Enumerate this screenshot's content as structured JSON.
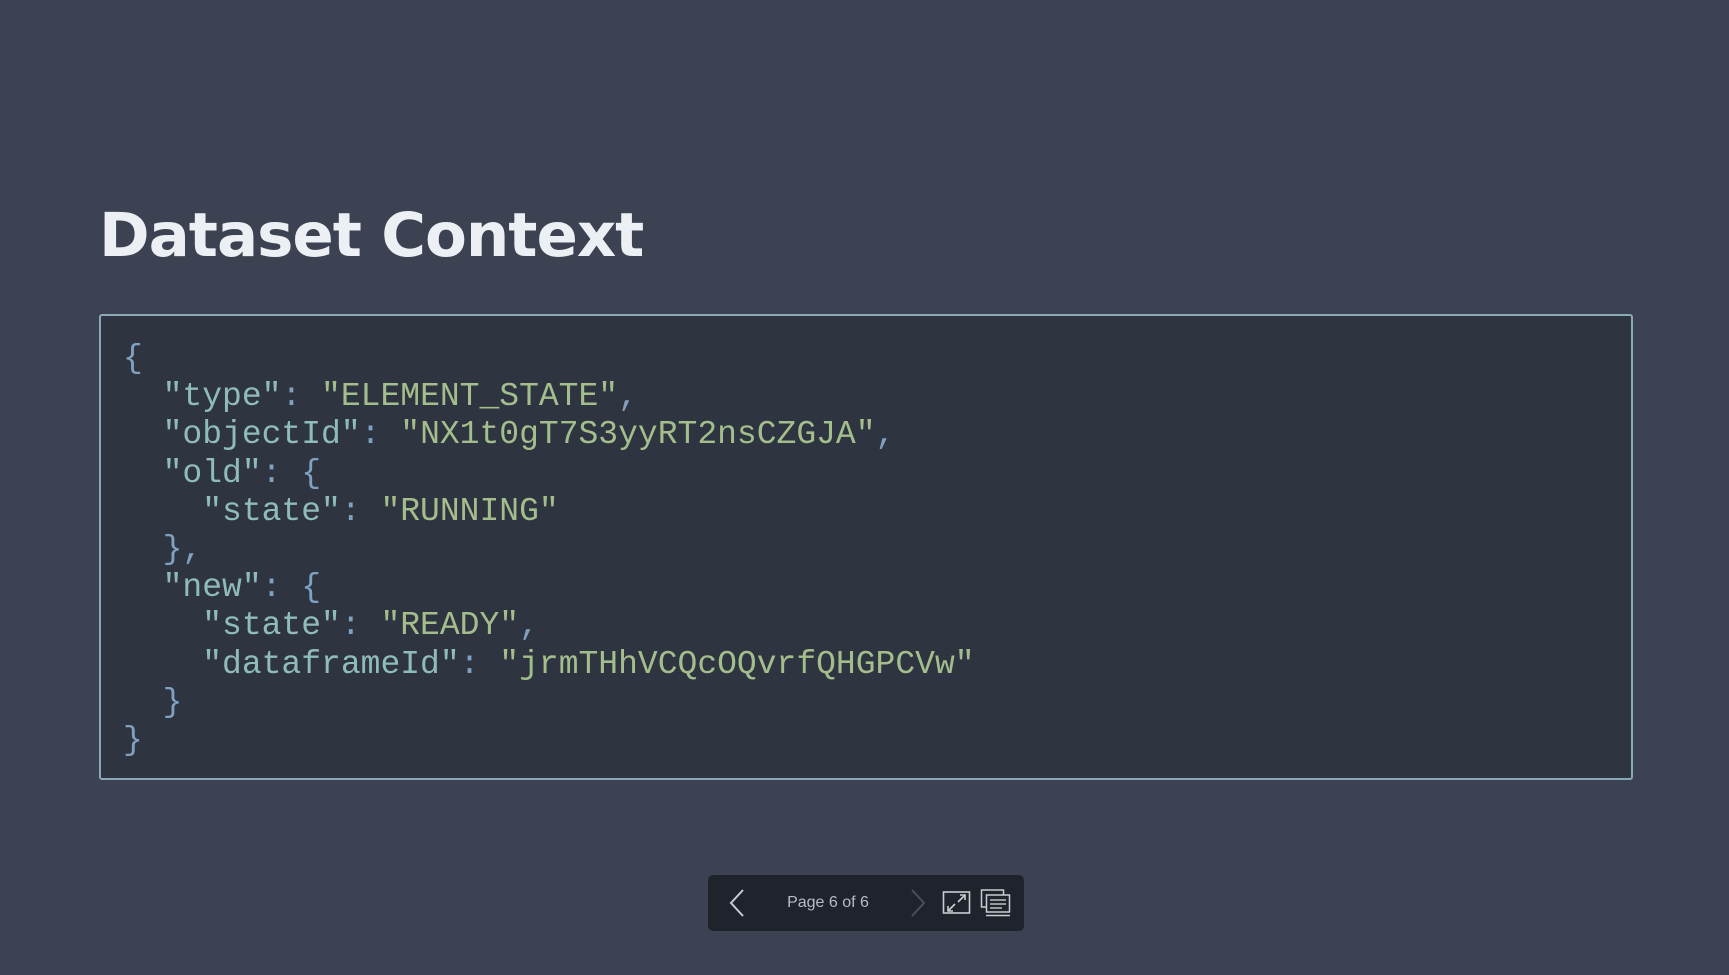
{
  "slide": {
    "title": "Dataset Context"
  },
  "code": {
    "lines": [
      [
        {
          "t": "{",
          "c": "punct"
        }
      ],
      [
        {
          "t": "  ",
          "c": "punct"
        },
        {
          "t": "\"type\"",
          "c": "key"
        },
        {
          "t": ": ",
          "c": "punct"
        },
        {
          "t": "\"ELEMENT_STATE\"",
          "c": "str"
        },
        {
          "t": ",",
          "c": "punct"
        }
      ],
      [
        {
          "t": "  ",
          "c": "punct"
        },
        {
          "t": "\"objectId\"",
          "c": "key"
        },
        {
          "t": ": ",
          "c": "punct"
        },
        {
          "t": "\"NX1t0gT7S3yyRT2nsCZGJA\"",
          "c": "str"
        },
        {
          "t": ",",
          "c": "punct"
        }
      ],
      [
        {
          "t": "  ",
          "c": "punct"
        },
        {
          "t": "\"old\"",
          "c": "key"
        },
        {
          "t": ": {",
          "c": "punct"
        }
      ],
      [
        {
          "t": "    ",
          "c": "punct"
        },
        {
          "t": "\"state\"",
          "c": "key"
        },
        {
          "t": ": ",
          "c": "punct"
        },
        {
          "t": "\"RUNNING\"",
          "c": "str"
        }
      ],
      [
        {
          "t": "  },",
          "c": "punct"
        }
      ],
      [
        {
          "t": "  ",
          "c": "punct"
        },
        {
          "t": "\"new\"",
          "c": "key"
        },
        {
          "t": ": {",
          "c": "punct"
        }
      ],
      [
        {
          "t": "    ",
          "c": "punct"
        },
        {
          "t": "\"state\"",
          "c": "key"
        },
        {
          "t": ": ",
          "c": "punct"
        },
        {
          "t": "\"READY\"",
          "c": "str"
        },
        {
          "t": ",",
          "c": "punct"
        }
      ],
      [
        {
          "t": "    ",
          "c": "punct"
        },
        {
          "t": "\"dataframeId\"",
          "c": "key"
        },
        {
          "t": ": ",
          "c": "punct"
        },
        {
          "t": "\"jrmTHhVCQcOQvrfQHGPCVw\"",
          "c": "str"
        }
      ],
      [
        {
          "t": "  }",
          "c": "punct"
        }
      ],
      [
        {
          "t": "}",
          "c": "punct"
        }
      ]
    ]
  },
  "navigation": {
    "page_indicator": "Page 6 of 6",
    "prev_icon": "chevron-left-icon",
    "next_icon": "chevron-right-icon",
    "fullscreen_icon": "fullscreen-icon",
    "notes_icon": "speaker-notes-icon",
    "next_disabled": true
  },
  "colors": {
    "background": "#3c4252",
    "code_background": "#2e3440",
    "code_border": "#88a9b6",
    "title": "#eceff4",
    "json_key": "#8fbcbb",
    "json_string": "#a3be8c",
    "json_punct": "#81a1c1",
    "nav_background": "#1f232b"
  }
}
